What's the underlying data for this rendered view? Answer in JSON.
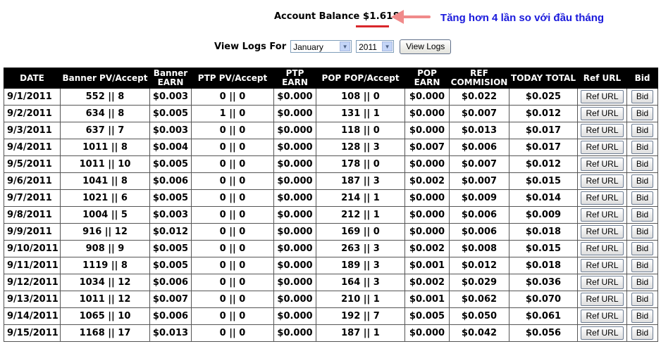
{
  "account": {
    "label": "Account Balance",
    "value": "$1.618"
  },
  "annotation": "Tăng hơn 4 lần so với đầu tháng",
  "view_logs": {
    "label": "View Logs For",
    "month": "January",
    "year": "2011",
    "button": "View Logs"
  },
  "table": {
    "headers": [
      "DATE",
      "Banner PV/Accept",
      "Banner EARN",
      "PTP PV/Accept",
      "PTP EARN",
      "POP POP/Accept",
      "POP EARN",
      "REF COMMISION",
      "TODAY TOTAL",
      "Ref URL",
      "Bid"
    ],
    "ref_button": "Ref URL",
    "bid_button": "Bid",
    "rows": [
      {
        "date": "9/1/2011",
        "banner_pv": "552 || 8",
        "banner_earn": "$0.003",
        "ptp_pv": "0 || 0",
        "ptp_earn": "$0.000",
        "pop_pv": "108 || 0",
        "pop_earn": "$0.000",
        "ref": "$0.022",
        "total": "$0.025"
      },
      {
        "date": "9/2/2011",
        "banner_pv": "634 || 8",
        "banner_earn": "$0.005",
        "ptp_pv": "1 || 0",
        "ptp_earn": "$0.000",
        "pop_pv": "131 || 1",
        "pop_earn": "$0.000",
        "ref": "$0.007",
        "total": "$0.012"
      },
      {
        "date": "9/3/2011",
        "banner_pv": "637 || 7",
        "banner_earn": "$0.003",
        "ptp_pv": "0 || 0",
        "ptp_earn": "$0.000",
        "pop_pv": "118 || 0",
        "pop_earn": "$0.000",
        "ref": "$0.013",
        "total": "$0.017"
      },
      {
        "date": "9/4/2011",
        "banner_pv": "1011 || 8",
        "banner_earn": "$0.004",
        "ptp_pv": "0 || 0",
        "ptp_earn": "$0.000",
        "pop_pv": "128 || 3",
        "pop_earn": "$0.007",
        "ref": "$0.006",
        "total": "$0.017"
      },
      {
        "date": "9/5/2011",
        "banner_pv": "1011 || 10",
        "banner_earn": "$0.005",
        "ptp_pv": "0 || 0",
        "ptp_earn": "$0.000",
        "pop_pv": "178 || 0",
        "pop_earn": "$0.000",
        "ref": "$0.007",
        "total": "$0.012"
      },
      {
        "date": "9/6/2011",
        "banner_pv": "1041 || 8",
        "banner_earn": "$0.006",
        "ptp_pv": "0 || 0",
        "ptp_earn": "$0.000",
        "pop_pv": "187 || 3",
        "pop_earn": "$0.002",
        "ref": "$0.007",
        "total": "$0.015"
      },
      {
        "date": "9/7/2011",
        "banner_pv": "1021 || 6",
        "banner_earn": "$0.005",
        "ptp_pv": "0 || 0",
        "ptp_earn": "$0.000",
        "pop_pv": "214 || 1",
        "pop_earn": "$0.000",
        "ref": "$0.009",
        "total": "$0.014"
      },
      {
        "date": "9/8/2011",
        "banner_pv": "1004 || 5",
        "banner_earn": "$0.003",
        "ptp_pv": "0 || 0",
        "ptp_earn": "$0.000",
        "pop_pv": "212 || 1",
        "pop_earn": "$0.000",
        "ref": "$0.006",
        "total": "$0.009"
      },
      {
        "date": "9/9/2011",
        "banner_pv": "916 || 12",
        "banner_earn": "$0.012",
        "ptp_pv": "0 || 0",
        "ptp_earn": "$0.000",
        "pop_pv": "169 || 0",
        "pop_earn": "$0.000",
        "ref": "$0.006",
        "total": "$0.018"
      },
      {
        "date": "9/10/2011",
        "banner_pv": "908 || 9",
        "banner_earn": "$0.005",
        "ptp_pv": "0 || 0",
        "ptp_earn": "$0.000",
        "pop_pv": "263 || 3",
        "pop_earn": "$0.002",
        "ref": "$0.008",
        "total": "$0.015"
      },
      {
        "date": "9/11/2011",
        "banner_pv": "1119 || 8",
        "banner_earn": "$0.005",
        "ptp_pv": "0 || 0",
        "ptp_earn": "$0.000",
        "pop_pv": "189 || 3",
        "pop_earn": "$0.001",
        "ref": "$0.012",
        "total": "$0.018"
      },
      {
        "date": "9/12/2011",
        "banner_pv": "1034 || 12",
        "banner_earn": "$0.006",
        "ptp_pv": "0 || 0",
        "ptp_earn": "$0.000",
        "pop_pv": "164 || 3",
        "pop_earn": "$0.002",
        "ref": "$0.029",
        "total": "$0.036"
      },
      {
        "date": "9/13/2011",
        "banner_pv": "1011 || 12",
        "banner_earn": "$0.007",
        "ptp_pv": "0 || 0",
        "ptp_earn": "$0.000",
        "pop_pv": "210 || 1",
        "pop_earn": "$0.001",
        "ref": "$0.062",
        "total": "$0.070"
      },
      {
        "date": "9/14/2011",
        "banner_pv": "1065 || 10",
        "banner_earn": "$0.006",
        "ptp_pv": "0 || 0",
        "ptp_earn": "$0.000",
        "pop_pv": "192 || 7",
        "pop_earn": "$0.005",
        "ref": "$0.050",
        "total": "$0.061"
      },
      {
        "date": "9/15/2011",
        "banner_pv": "1168 || 17",
        "banner_earn": "$0.013",
        "ptp_pv": "0 || 0",
        "ptp_earn": "$0.000",
        "pop_pv": "187 || 1",
        "pop_earn": "$0.000",
        "ref": "$0.042",
        "total": "$0.056"
      }
    ]
  },
  "colors": {
    "header_bg": "#000000",
    "header_text": "#ffffff",
    "annotation": "#1a1adc",
    "highlight": "#d9262b",
    "arrow": "#f08a8a"
  }
}
